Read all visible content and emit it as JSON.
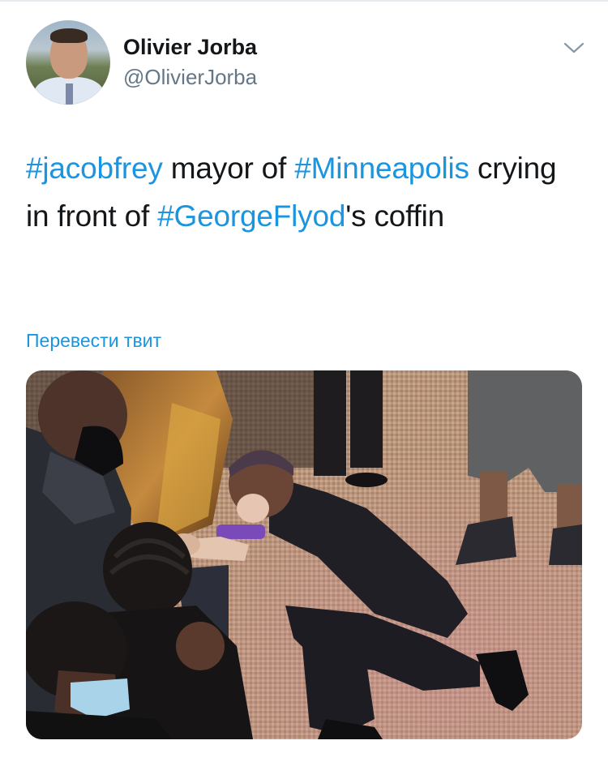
{
  "tweet": {
    "author": {
      "display_name": "Olivier Jorba",
      "handle": "@OlivierJorba"
    },
    "text_segments": [
      {
        "text": "#jacobfrey",
        "type": "hashtag"
      },
      {
        "text": " mayor of ",
        "type": "text"
      },
      {
        "text": "#Minneapolis",
        "type": "hashtag"
      },
      {
        "text": " crying in front of ",
        "type": "text"
      },
      {
        "text": "#GeorgeFlyod",
        "type": "hashtag"
      },
      {
        "text": "'s coffin",
        "type": "text"
      }
    ],
    "translate_label": "Перевести твит",
    "menu_icon": "chevron-down-icon",
    "colors": {
      "link": "#1b95e0",
      "text": "#14171a",
      "secondary": "#657786"
    }
  }
}
